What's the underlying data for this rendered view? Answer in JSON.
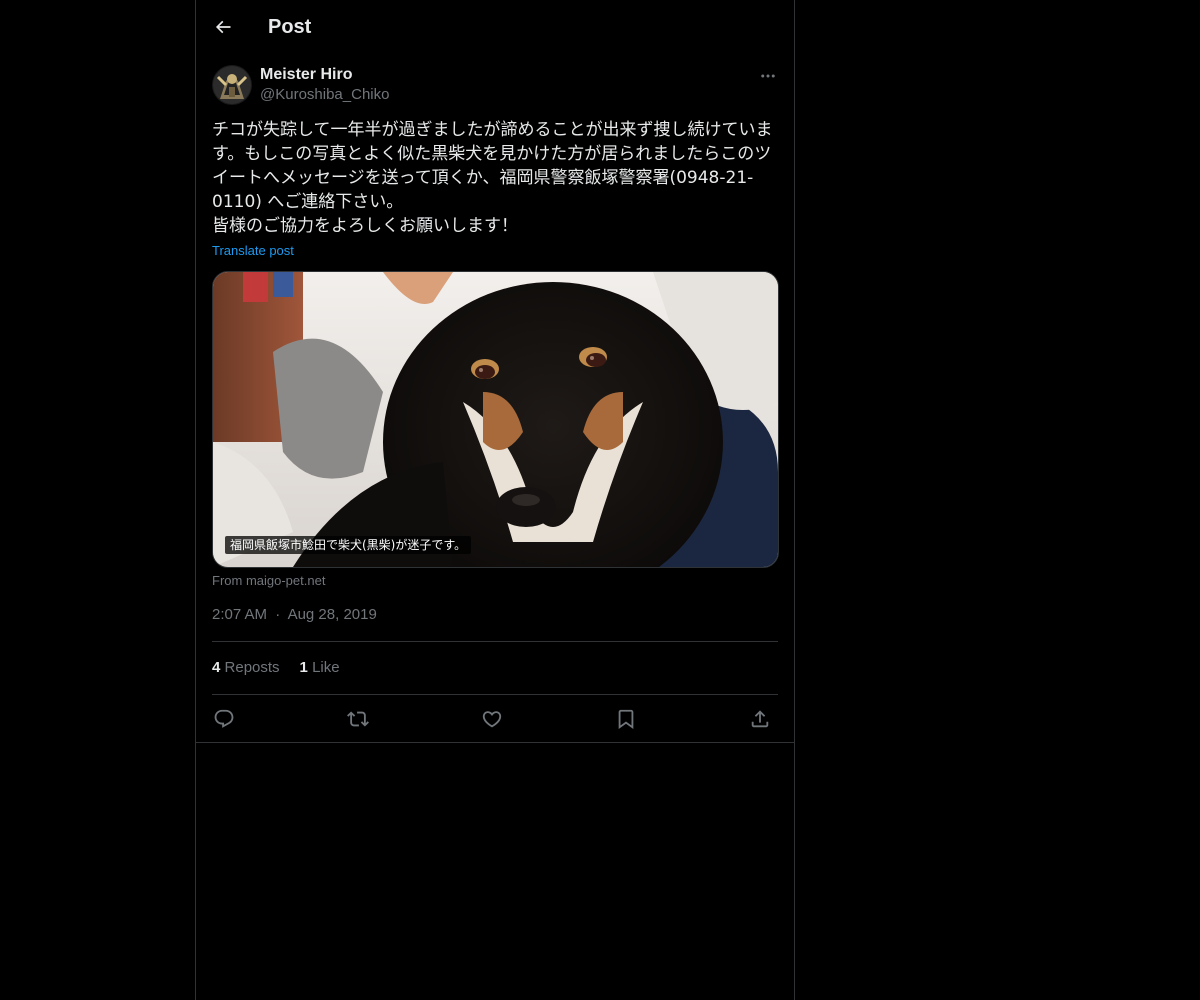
{
  "header": {
    "title": "Post",
    "back_icon": "arrow-left-icon"
  },
  "post": {
    "author_name": "Meister Hiro",
    "author_handle": "@Kuroshiba_Chiko",
    "text": "チコが失踪して一年半が過ぎましたが諦めることが出来ず捜し続けています。もしこの写真とよく似た黒柴犬を見かけた方が居られましたらこのツイートへメッセージを送って頂くか、福岡県警察飯塚警察署(0948-21-0110) へご連絡下さい。\n皆様のご協力をよろしくお願いします！",
    "translate_label": "Translate post",
    "media_caption": "福岡県飯塚市鯰田で柴犬(黒柴)が迷子です。",
    "media_source": "From maigo-pet.net",
    "time": "2:07 AM",
    "separator": "·",
    "date": "Aug 28, 2019"
  },
  "stats": {
    "reposts_count": "4",
    "reposts_label": "Reposts",
    "likes_count": "1",
    "likes_label": "Like"
  },
  "actions": {
    "icons": [
      "reply-icon",
      "repost-icon",
      "like-icon",
      "bookmark-icon",
      "share-icon"
    ]
  },
  "colors": {
    "background": "#000000",
    "text_primary": "#e7e9ea",
    "text_secondary": "#71767b",
    "link": "#1d9bf0",
    "border": "#2f3336"
  }
}
